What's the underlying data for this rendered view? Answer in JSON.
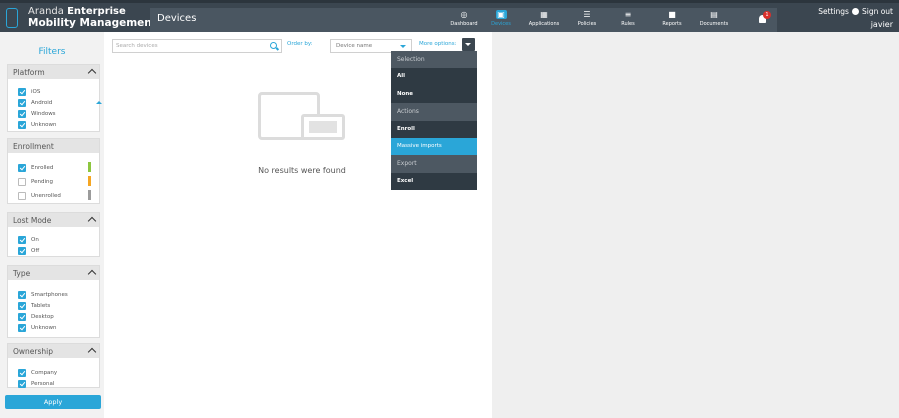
{
  "header": {
    "logo_line1_prefix": "Aranda",
    "logo_line1_bold": "Enterprise",
    "logo_line2": "Mobility Management",
    "section_title": "Devices",
    "nav": [
      {
        "label": "Dashboard",
        "icon": "dashboard-icon",
        "glyph": "◎"
      },
      {
        "label": "Devices",
        "icon": "devices-icon",
        "glyph": "▣",
        "active": true
      },
      {
        "label": "Applications",
        "icon": "applications-icon",
        "glyph": "▦"
      },
      {
        "label": "Policies",
        "icon": "policies-icon",
        "glyph": "☰"
      },
      {
        "label": "Rules",
        "icon": "rules-icon",
        "glyph": "≡"
      },
      {
        "label": "Reports",
        "icon": "reports-icon",
        "glyph": "■"
      },
      {
        "label": "Documents",
        "icon": "documents-icon",
        "glyph": "▤"
      }
    ],
    "notifications": "1",
    "settings": "Settings",
    "sign_out": "Sign out",
    "user": "javier"
  },
  "sidebar": {
    "title": "Filters",
    "apply": "Apply",
    "platform": {
      "title": "Platform",
      "options": [
        {
          "label": "iOS",
          "checked": true
        },
        {
          "label": "Android",
          "checked": true
        },
        {
          "label": "Windows",
          "checked": true
        },
        {
          "label": "Unknown",
          "checked": true
        }
      ]
    },
    "enrollment": {
      "title": "Enrollment",
      "options": [
        {
          "label": "Enrolled",
          "checked": true,
          "color": "#8dc63f"
        },
        {
          "label": "Pending",
          "checked": false,
          "color": "#f5a623"
        },
        {
          "label": "Unenrolled",
          "checked": false,
          "color": "#9b9b9b"
        }
      ]
    },
    "lost_mode": {
      "title": "Lost Mode",
      "options": [
        {
          "label": "On",
          "checked": true
        },
        {
          "label": "Off",
          "checked": true
        }
      ]
    },
    "type": {
      "title": "Type",
      "options": [
        {
          "label": "Smartphones",
          "checked": true
        },
        {
          "label": "Tablets",
          "checked": true
        },
        {
          "label": "Desktop",
          "checked": true
        },
        {
          "label": "Unknown",
          "checked": true
        }
      ]
    },
    "ownership": {
      "title": "Ownership",
      "options": [
        {
          "label": "Company",
          "checked": true
        },
        {
          "label": "Personal",
          "checked": true
        }
      ]
    }
  },
  "main": {
    "search_placeholder": "Search devices",
    "order_by_label": "Order by:",
    "order_by_value": "Device name",
    "more_options_label": "More options:",
    "empty_message": "No results were found"
  },
  "menu": {
    "rows": [
      {
        "label": "Selection",
        "kind": "section"
      },
      {
        "label": "All",
        "kind": "item"
      },
      {
        "label": "None",
        "kind": "item"
      },
      {
        "label": "Actions",
        "kind": "section"
      },
      {
        "label": "Enroll",
        "kind": "item"
      },
      {
        "label": "Massive imports",
        "kind": "item",
        "highlighted": true
      },
      {
        "label": "Export",
        "kind": "section"
      },
      {
        "label": "Excel",
        "kind": "item"
      }
    ]
  }
}
